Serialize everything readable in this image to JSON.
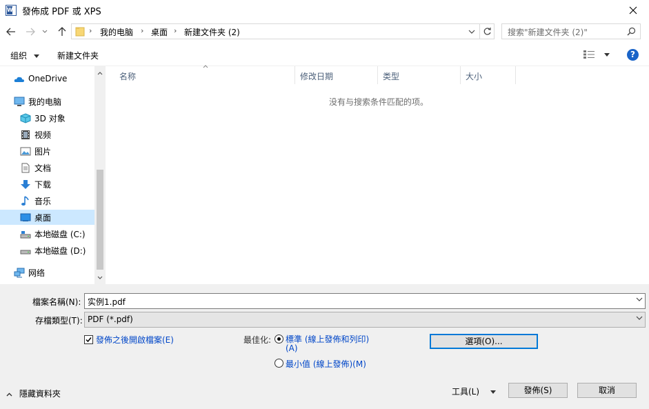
{
  "window": {
    "title": "發佈成 PDF 或 XPS"
  },
  "address": {
    "crumbs": [
      "我的电脑",
      "桌面",
      "新建文件夹 (2)"
    ],
    "search_placeholder": "搜索\"新建文件夹 (2)\""
  },
  "toolbar": {
    "organize": "组织",
    "new_folder": "新建文件夹"
  },
  "sidebar": {
    "items": [
      {
        "label": "OneDrive",
        "icon": "cloud-icon"
      },
      {
        "label": "我的电脑",
        "icon": "computer-icon"
      },
      {
        "label": "3D 对象",
        "icon": "cube-icon"
      },
      {
        "label": "视频",
        "icon": "film-icon"
      },
      {
        "label": "图片",
        "icon": "picture-icon"
      },
      {
        "label": "文档",
        "icon": "document-icon"
      },
      {
        "label": "下载",
        "icon": "download-arrow-icon"
      },
      {
        "label": "音乐",
        "icon": "music-note-icon"
      },
      {
        "label": "桌面",
        "icon": "desktop-icon",
        "selected": true
      },
      {
        "label": "本地磁盘 (C:)",
        "icon": "drive-icon"
      },
      {
        "label": "本地磁盘 (D:)",
        "icon": "drive-icon"
      },
      {
        "label": "网络",
        "icon": "network-icon"
      }
    ]
  },
  "filelist": {
    "columns": [
      "名称",
      "修改日期",
      "类型",
      "大小"
    ],
    "empty_message": "没有与搜索条件匹配的项。"
  },
  "form": {
    "filename_label": "檔案名稱(N):",
    "filename_value": "实例1.pdf",
    "filetype_label": "存檔類型(T):",
    "filetype_value": "PDF (*.pdf)",
    "open_after_publish": "發佈之後開啟檔案(E)",
    "optimize_label": "最佳化:",
    "optimize_standard_line1": "標準 (線上發佈和列印)",
    "optimize_standard_line2": "(A)",
    "optimize_minimum": "最小值 (線上發佈)(M)",
    "options_button": "選項(O)..."
  },
  "footer": {
    "hide_folders": "隱藏資料夾",
    "tools": "工具(L)",
    "publish": "發佈(S)",
    "cancel": "取消"
  },
  "colors": {
    "accent": "#0078d7",
    "selected": "#cce8ff",
    "link": "#0046c8"
  }
}
